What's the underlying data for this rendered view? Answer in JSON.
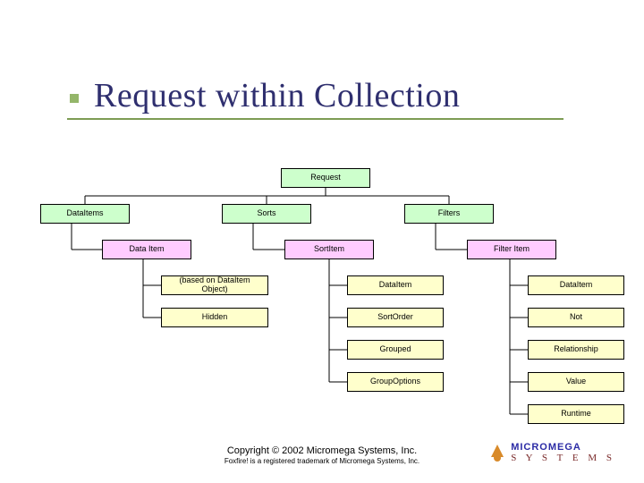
{
  "title": "Request within Collection",
  "nodes": {
    "request": "Request",
    "dataitems": "DataItems",
    "sorts": "Sorts",
    "filters": "Filters",
    "dataitem": "Data Item",
    "sortitem": "SortItem",
    "filteritem": "Filter Item",
    "di_based": "(based on DataItem Object)",
    "di_hidden": "Hidden",
    "si_dataitem": "DataItem",
    "si_sortorder": "SortOrder",
    "si_grouped": "Grouped",
    "si_groupoptions": "GroupOptions",
    "fi_dataitem": "DataItem",
    "fi_not": "Not",
    "fi_relationship": "Relationship",
    "fi_value": "Value",
    "fi_runtime": "Runtime"
  },
  "footer": {
    "copyright": "Copyright © 2002 Micromega Systems, Inc.",
    "trademark": "Foxfire! is a registered trademark of Micromega Systems, Inc."
  },
  "logo": {
    "slashes": "S  Y  S  T  E  M  S",
    "word": "MICROMEGA"
  }
}
